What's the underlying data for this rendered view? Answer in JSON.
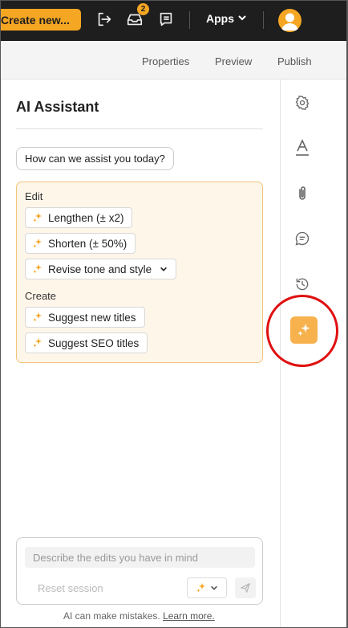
{
  "topbar": {
    "create_label": "Create new...",
    "notification_count": "2",
    "apps_label": "Apps",
    "icons": [
      "exit-icon",
      "inbox-icon",
      "notes-icon",
      "chevron-down-icon",
      "user-avatar-icon"
    ]
  },
  "subnav": {
    "tabs": [
      "Properties",
      "Preview",
      "Publish"
    ]
  },
  "panel": {
    "title": "AI Assistant",
    "prompt": "How can we assist you today?",
    "edit_label": "Edit",
    "edit_actions": [
      "Lengthen (± x2)",
      "Shorten (± 50%)",
      "Revise tone and style"
    ],
    "create_label": "Create",
    "create_actions": [
      "Suggest new titles",
      "Suggest SEO titles"
    ]
  },
  "rail": {
    "icons": [
      "settings-icon",
      "typography-icon",
      "attachment-icon",
      "comment-icon",
      "history-icon",
      "ai-sparkle-icon"
    ]
  },
  "composer": {
    "placeholder": "Describe the edits you have in mind",
    "reset_label": "Reset session",
    "disclaimer": "AI can make mistakes.",
    "learn_more": "Learn more."
  },
  "colors": {
    "accent": "#f5a623",
    "topbar": "#1e1e1e",
    "highlight": "#e01010"
  }
}
